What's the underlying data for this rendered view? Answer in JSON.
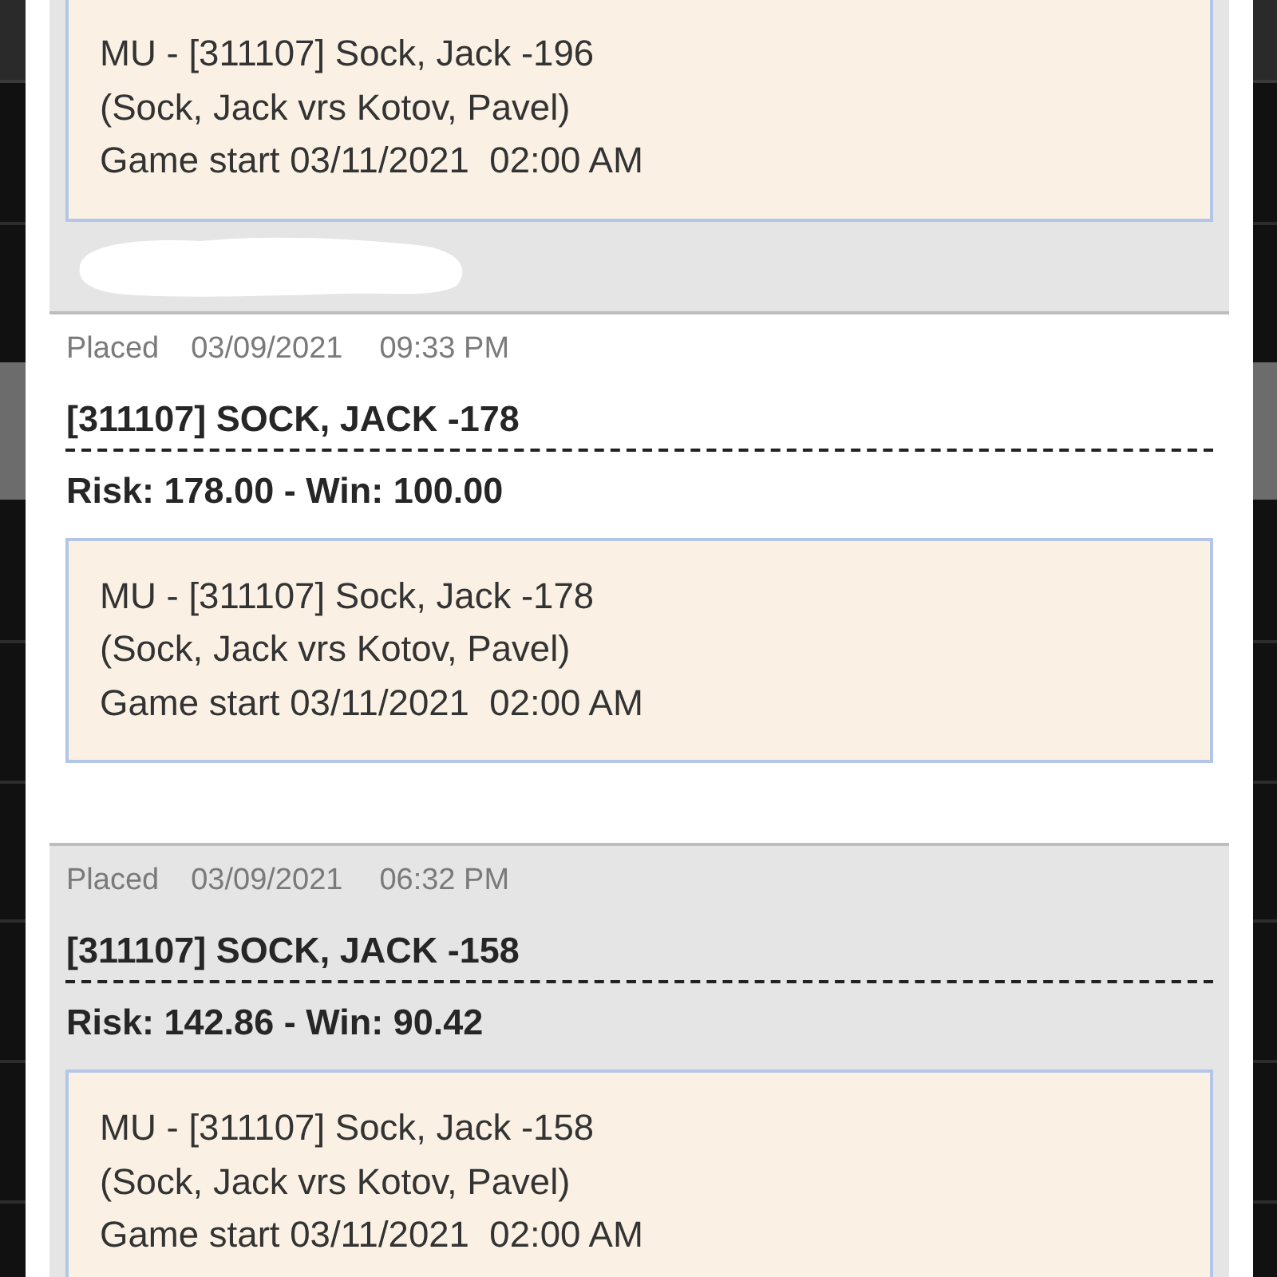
{
  "bets": [
    {
      "detail_lines": [
        "MU - [311107] Sock, Jack -196",
        "(Sock, Jack vrs Kotov, Pavel)",
        "Game start 03/11/2021  02:00 AM"
      ],
      "redacted": true
    },
    {
      "status": "Placed",
      "date": "03/09/2021",
      "time": "09:33 PM",
      "title": "[311107] SOCK, JACK -178",
      "stake": "Risk: 178.00 - Win: 100.00",
      "detail_lines": [
        "MU - [311107] Sock, Jack -178",
        "(Sock, Jack vrs Kotov, Pavel)",
        "Game start 03/11/2021  02:00 AM"
      ]
    },
    {
      "status": "Placed",
      "date": "03/09/2021",
      "time": "06:32 PM",
      "title": "[311107] SOCK, JACK -158",
      "stake": "Risk: 142.86 - Win: 90.42",
      "detail_lines": [
        "MU - [311107] Sock, Jack -158",
        "(Sock, Jack vrs Kotov, Pavel)",
        "Game start 03/11/2021  02:00 AM"
      ]
    }
  ]
}
